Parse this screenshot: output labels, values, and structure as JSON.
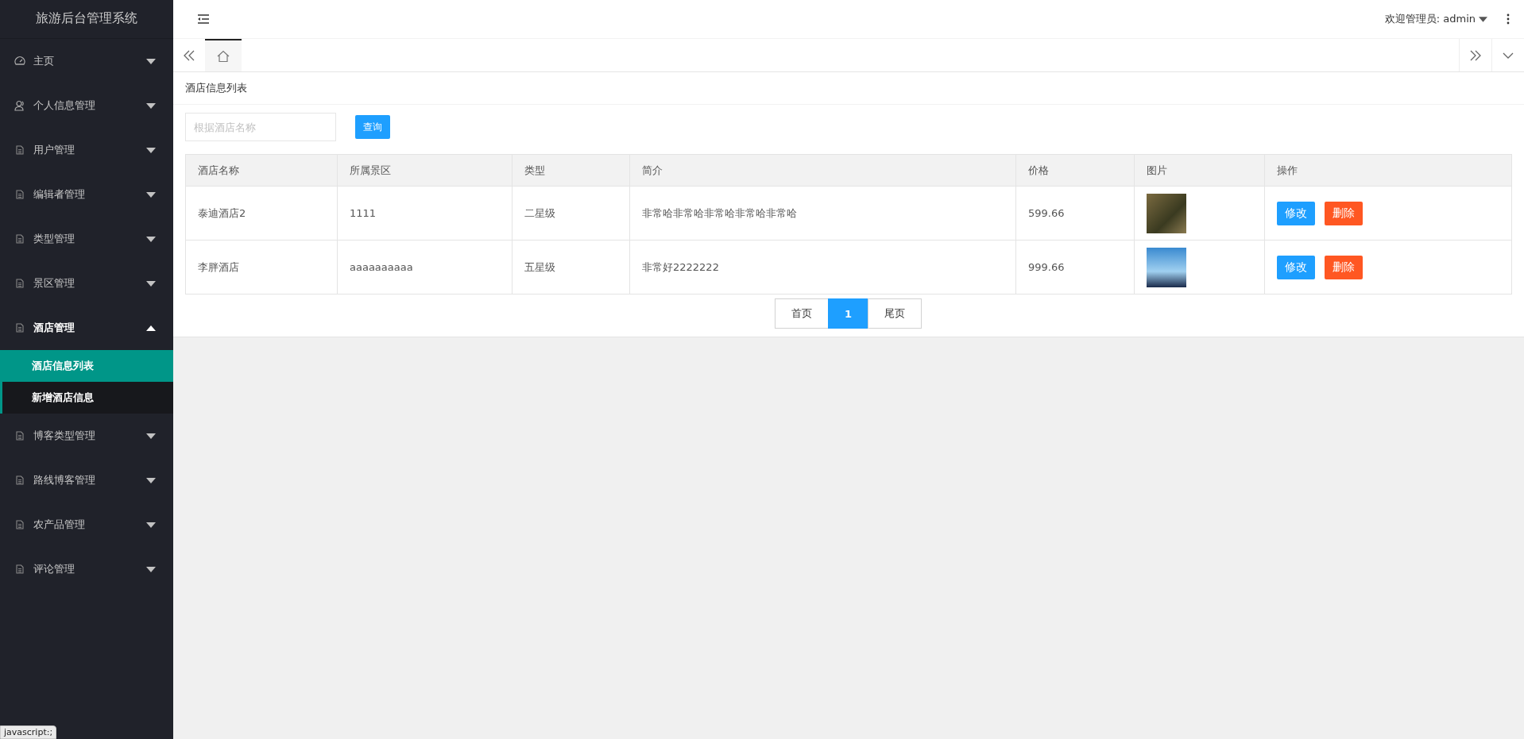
{
  "sidebar": {
    "title": "旅游后台管理系统",
    "items": [
      {
        "label": "主页",
        "kind": "gauge",
        "expanded": false
      },
      {
        "label": "个人信息管理",
        "kind": "user",
        "expanded": false
      },
      {
        "label": "用户管理",
        "kind": "doc",
        "expanded": false
      },
      {
        "label": "编辑者管理",
        "kind": "doc",
        "expanded": false
      },
      {
        "label": "类型管理",
        "kind": "doc",
        "expanded": false
      },
      {
        "label": "景区管理",
        "kind": "doc",
        "expanded": false
      },
      {
        "label": "酒店管理",
        "kind": "doc",
        "expanded": true,
        "children": [
          {
            "label": "酒店信息列表",
            "selected": true
          },
          {
            "label": "新增酒店信息",
            "selected": false
          }
        ]
      },
      {
        "label": "博客类型管理",
        "kind": "doc",
        "expanded": false
      },
      {
        "label": "路线博客管理",
        "kind": "doc",
        "expanded": false
      },
      {
        "label": "农产品管理",
        "kind": "doc",
        "expanded": false
      },
      {
        "label": "评论管理",
        "kind": "doc",
        "expanded": false
      }
    ]
  },
  "header": {
    "welcome": "欢迎管理员: admin"
  },
  "page_title": "酒店信息列表",
  "search": {
    "placeholder": "根据酒店名称",
    "button": "查询"
  },
  "table": {
    "columns": [
      "酒店名称",
      "所属景区",
      "类型",
      "简介",
      "价格",
      "图片",
      "操作"
    ],
    "rows": [
      {
        "name": "泰迪酒店2",
        "scenic": "1111",
        "type": "二星级",
        "intro": "非常哈非常哈非常哈非常哈非常哈",
        "price": "599.66",
        "edit": "修改",
        "delete": "删除"
      },
      {
        "name": "李胖酒店",
        "scenic": "aaaaaaaaaa",
        "type": "五星级",
        "intro": "非常好2222222",
        "price": "999.66",
        "edit": "修改",
        "delete": "删除"
      }
    ]
  },
  "pagination": [
    {
      "label": "首页",
      "selected": false
    },
    {
      "label": "1",
      "selected": true
    },
    {
      "label": "尾页",
      "selected": false
    }
  ],
  "status_tip": "javascript:;"
}
